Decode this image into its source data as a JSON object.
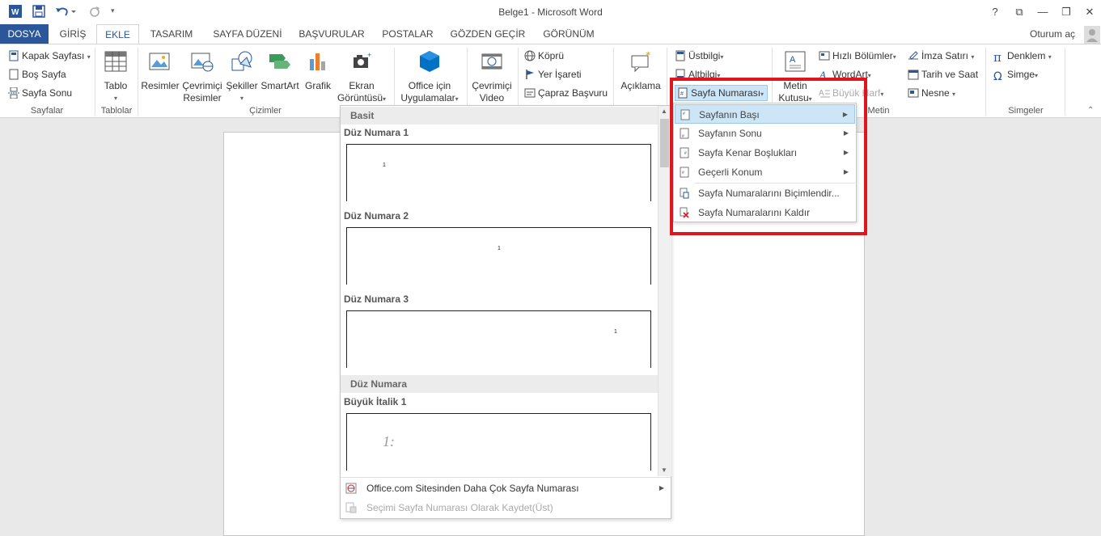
{
  "window": {
    "title": "Belge1 - Microsoft Word",
    "controls": [
      "?",
      "⧉",
      "—",
      "❐",
      "✕"
    ]
  },
  "tabs": [
    "DOSYA",
    "GİRİŞ",
    "EKLE",
    "TASARIM",
    "SAYFA DÜZENİ",
    "BAŞVURULAR",
    "POSTALAR",
    "GÖZDEN GEÇİR",
    "GÖRÜNÜM"
  ],
  "active_tab": "EKLE",
  "signin": "Oturum aç",
  "ribbon": {
    "pages": {
      "label": "Sayfalar",
      "items": [
        "Kapak Sayfası",
        "Boş Sayfa",
        "Sayfa Sonu"
      ]
    },
    "tables": {
      "label": "Tablolar",
      "items": [
        "Tablo"
      ]
    },
    "illustrations": {
      "label": "Çizimler",
      "items": [
        "Resimler",
        "Çevrimiçi",
        "Resimler",
        "Şekiller",
        "SmartArt",
        "Grafik",
        "Ekran",
        "Görüntüsü"
      ]
    },
    "apps": {
      "line1": "Office için",
      "line2": "Uygulamalar"
    },
    "media": {
      "line1": "Çevrimiçi",
      "line2": "Video"
    },
    "links": {
      "items": [
        "Köprü",
        "Yer İşareti",
        "Çapraz Başvuru"
      ]
    },
    "comments": {
      "items": [
        "Açıklama"
      ]
    },
    "header_footer": {
      "items": [
        "Üstbilgi",
        "Altbilgi",
        "Sayfa Numarası"
      ]
    },
    "text": {
      "label": "Metin",
      "textbox_line1": "Metin",
      "textbox_line2": "Kutusu",
      "items": [
        "Hızlı Bölümler",
        "WordArt",
        "Büyük Harf",
        "İmza Satırı",
        "Tarih ve Saat",
        "Nesne"
      ]
    },
    "symbols": {
      "label": "Simgeler",
      "items": [
        "Denklem",
        "Simge"
      ]
    }
  },
  "gallery": {
    "sections": [
      "Basit",
      "Düz Numara"
    ],
    "items": [
      {
        "title": "Düz Numara 1",
        "num": "1"
      },
      {
        "title": "Düz Numara 2",
        "num": "1"
      },
      {
        "title": "Düz Numara 3",
        "num": "1"
      },
      {
        "title": "Büyük İtalik 1",
        "num": "1:"
      }
    ],
    "footer": [
      "Office.com Sitesinden Daha Çok Sayfa Numarası",
      "Seçimi Sayfa Numarası Olarak Kaydet(Üst)"
    ]
  },
  "submenu": {
    "items": [
      "Sayfanın Başı",
      "Sayfanın Sonu",
      "Sayfa Kenar Boşlukları",
      "Geçerli Konum",
      "Sayfa Numaralarını Biçimlendir...",
      "Sayfa Numaralarını Kaldır"
    ]
  },
  "colors": {
    "accent": "#2b579a",
    "highlight": "#e0151e",
    "hover": "#cde6f7"
  }
}
